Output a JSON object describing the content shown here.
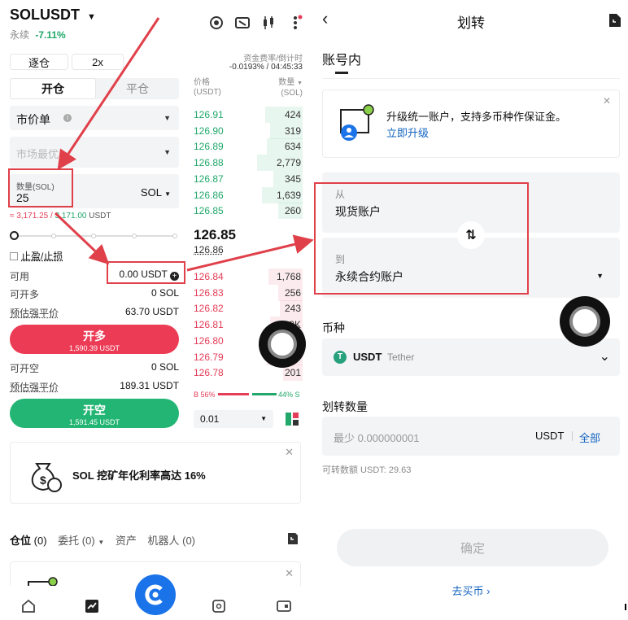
{
  "left": {
    "pair": "SOLUSDT",
    "contract_type": "永续",
    "change": "-7.11%",
    "margin_mode": "逐仓",
    "leverage": "2x",
    "funding_label": "资金费率/倒计时",
    "funding_value": "-0.0193% / 04:45:33",
    "tab_open": "开仓",
    "tab_close": "平仓",
    "order_type": "市价单",
    "price_placeholder": "市场最优",
    "qty_label": "数量(SOL)",
    "qty_value": "25",
    "qty_unit": "SOL",
    "qty_hint_a": "≈ 3,171.25 / ",
    "qty_hint_b": "3,171.00",
    "qty_hint_unit": " USDT",
    "tpsl_label": "止盈/止损",
    "available_label": "可用",
    "available_value": "0.00 USDT",
    "can_open_long_label": "可开多",
    "can_open_long_value": "0 SOL",
    "liq_price_long_label": "预估强平价",
    "liq_price_long_value": "63.70 USDT",
    "long_button": "开多",
    "long_button_sub": "1,590.39 USDT",
    "can_open_short_label": "可开空",
    "can_open_short_value": "0 SOL",
    "liq_price_short_label": "预估强平价",
    "liq_price_short_value": "189.31 USDT",
    "short_button": "开空",
    "short_button_sub": "1,591.45 USDT",
    "banner_text": "SOL 挖矿年化利率高达 16%",
    "bottom_tabs": [
      "仓位",
      "(0)",
      "委托",
      "(0)",
      "资产",
      "机器人 (0)"
    ]
  },
  "orderbook": {
    "price_header": "价格",
    "price_unit": "(USDT)",
    "qty_header": "数量",
    "qty_unit": "(SOL)",
    "asks": [
      {
        "price": "126.91",
        "qty": "424"
      },
      {
        "price": "126.90",
        "qty": "319"
      },
      {
        "price": "126.89",
        "qty": "634"
      },
      {
        "price": "126.88",
        "qty": "2,779"
      },
      {
        "price": "126.87",
        "qty": "345"
      },
      {
        "price": "126.86",
        "qty": "1,639"
      },
      {
        "price": "126.85",
        "qty": "260"
      }
    ],
    "last_price": "126.85",
    "mark_price": "126.86",
    "bids": [
      {
        "price": "126.84",
        "qty": "1,768"
      },
      {
        "price": "126.83",
        "qty": "256"
      },
      {
        "price": "126.82",
        "qty": "243"
      },
      {
        "price": "126.81",
        "qty": "1.9K"
      },
      {
        "price": "126.80",
        "qty": ""
      },
      {
        "price": "126.79",
        "qty": ""
      },
      {
        "price": "126.78",
        "qty": "201"
      }
    ],
    "buy_ratio": "B 56%",
    "sell_ratio": "44% S",
    "buy_fraction": 0.56,
    "precision": "0.01"
  },
  "right": {
    "title": "划转",
    "section": "账号内",
    "upgrade_text": "升级统一账户，支持多币种作保证金。",
    "upgrade_link": "立即升级",
    "from_label": "从",
    "from_value": "现货账户",
    "to_label": "到",
    "to_value": "永续合约账户",
    "coin_label": "币种",
    "coin_symbol": "USDT",
    "coin_name": "Tether",
    "amount_label": "划转数量",
    "amount_placeholder": "最少 0.000000001",
    "amount_unit": "USDT",
    "amount_all": "全部",
    "transferable": "可转数额 USDT: 29.63",
    "confirm": "确定",
    "buy_link": "去买币"
  },
  "colors": {
    "green": "#21a86a",
    "red": "#e43d57",
    "blue": "#1565c0",
    "annotation_red": "#e0404a"
  }
}
